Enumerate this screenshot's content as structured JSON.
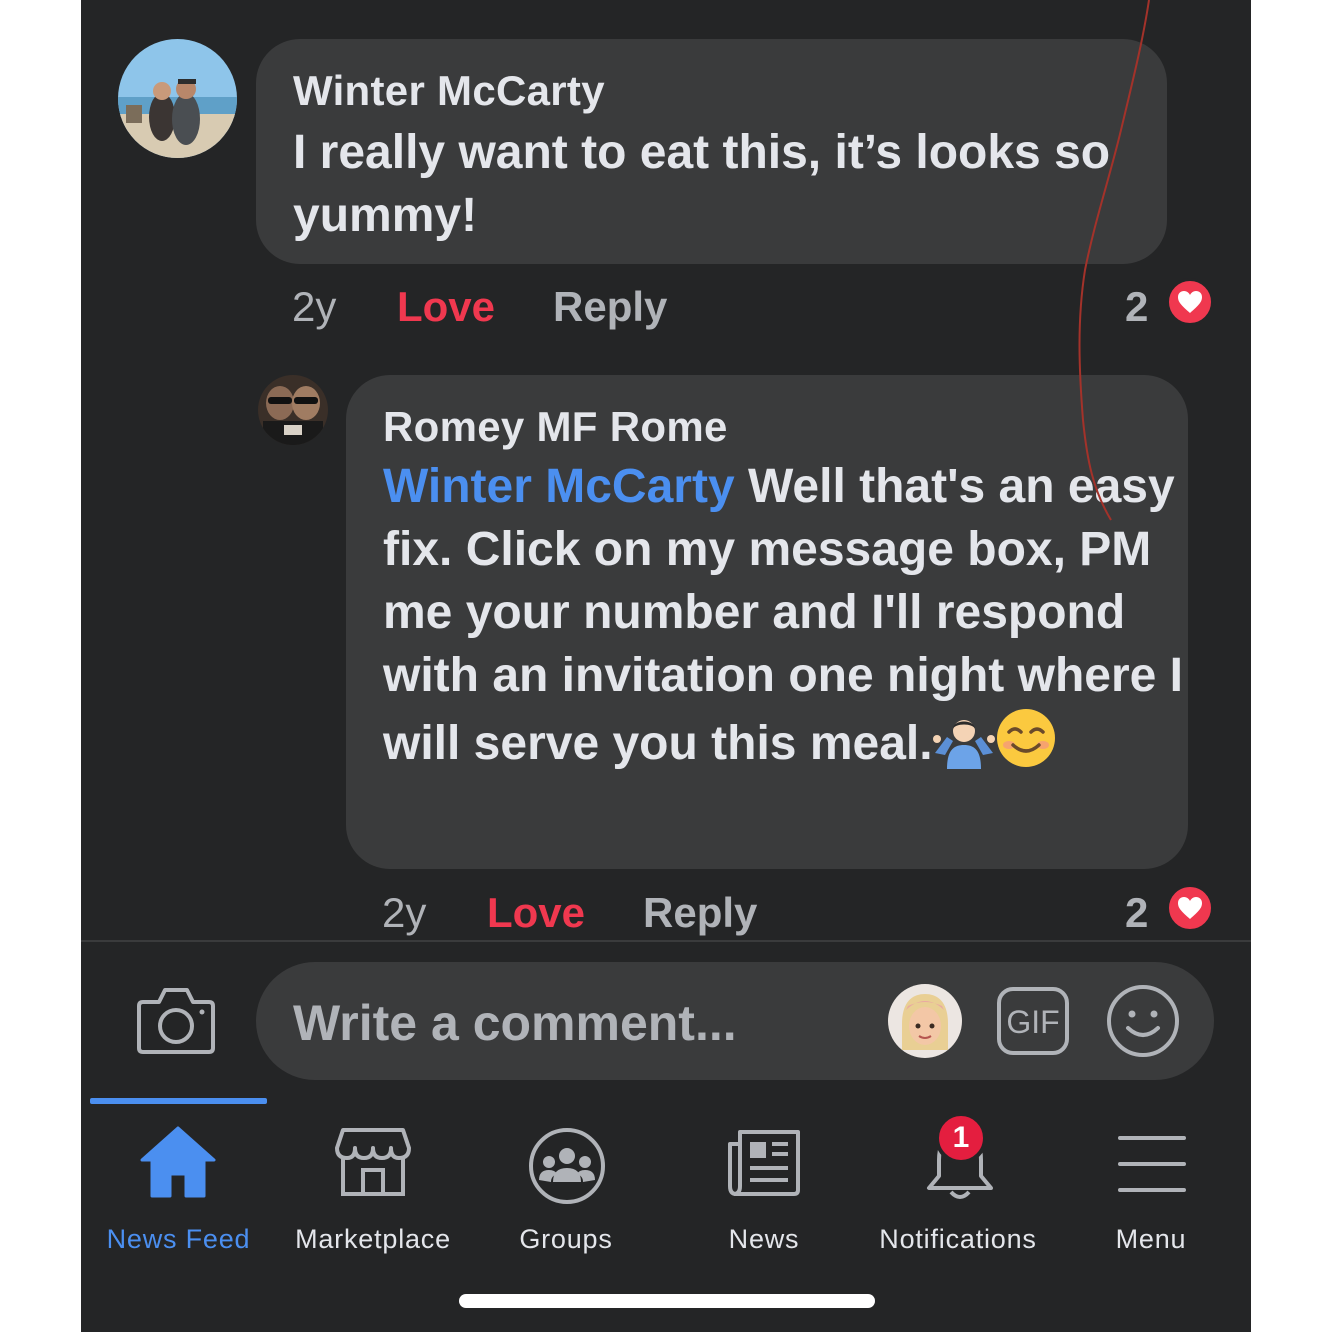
{
  "comments": [
    {
      "author": "Winter McCarty",
      "text": "I really want to eat this, it’s looks so yummy!",
      "time": "2y",
      "love_label": "Love",
      "reply_label": "Reply",
      "reaction_count": "2"
    },
    {
      "author": "Romey MF Rome",
      "mention": "Winter McCarty",
      "text": " Well that's an easy fix. Click on my message box, PM me your number and I'll respond with an invitation one night where I will serve you this meal.",
      "time": "2y",
      "love_label": "Love",
      "reply_label": "Reply",
      "reaction_count": "2"
    }
  ],
  "composer": {
    "placeholder": "Write a comment...",
    "gif_label": "GIF"
  },
  "tabbar": {
    "active_tab": "News Feed",
    "tabs": [
      {
        "label": "News Feed",
        "icon": "home-icon"
      },
      {
        "label": "Marketplace",
        "icon": "storefront-icon"
      },
      {
        "label": "Groups",
        "icon": "groups-icon"
      },
      {
        "label": "News",
        "icon": "newspaper-icon"
      },
      {
        "label": "Notifications",
        "icon": "bell-icon",
        "badge": "1"
      },
      {
        "label": "Menu",
        "icon": "hamburger-menu-icon"
      }
    ]
  },
  "colors": {
    "background": "#242526",
    "bubble": "#3a3b3c",
    "accent_blue": "#4b8ff0",
    "love_red": "#f0384f",
    "text_primary": "#e4e6eb",
    "text_secondary": "#b0b3b8"
  }
}
